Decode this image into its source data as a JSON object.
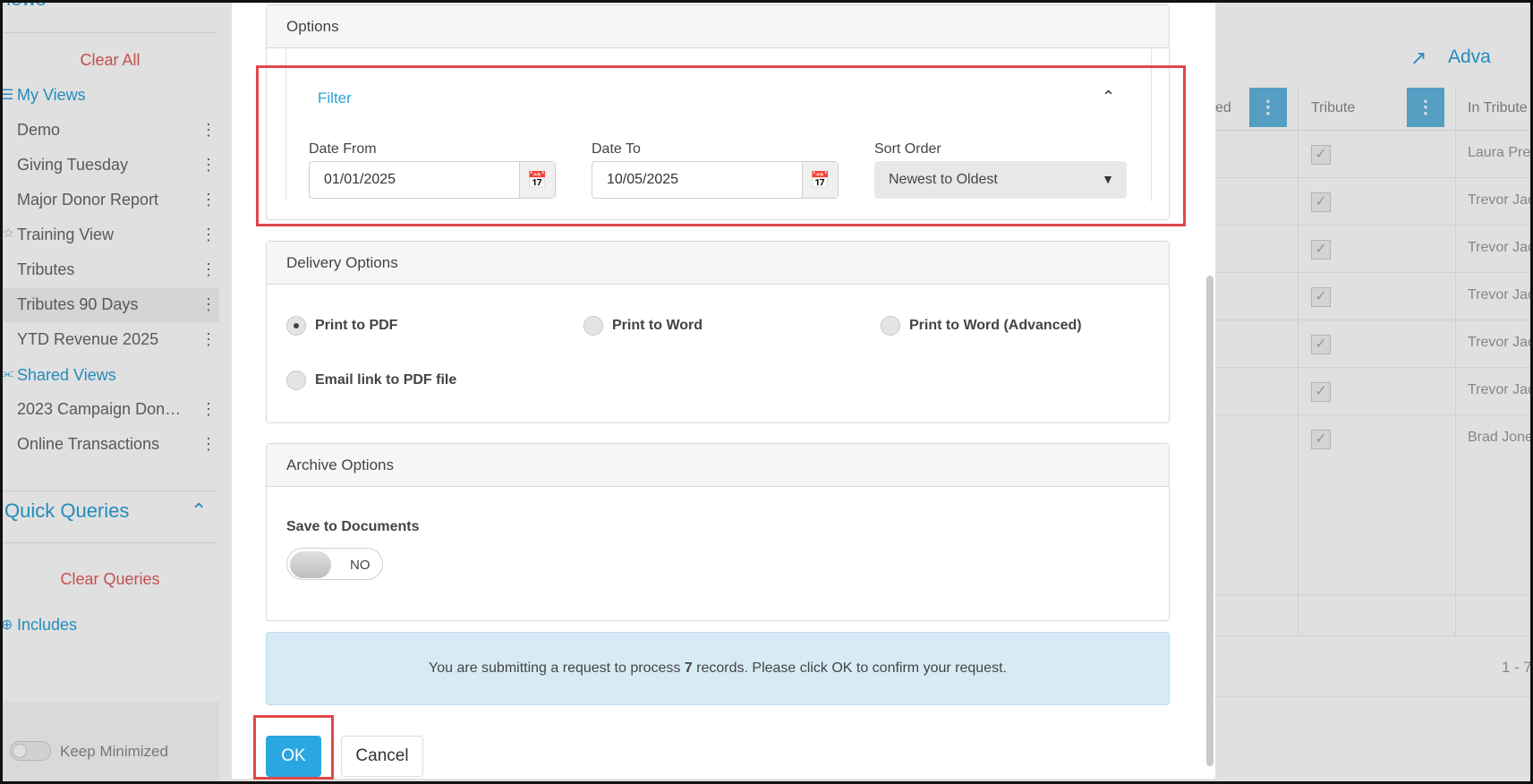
{
  "sidebar": {
    "views_title": "Views",
    "clear_all": "Clear All",
    "my_views_title": "My Views",
    "my_views": [
      "Demo",
      "Giving Tuesday",
      "Major Donor Report",
      "Training View",
      "Tributes",
      "Tributes 90 Days",
      "YTD Revenue 2025"
    ],
    "shared_views_title": "Shared Views",
    "shared_views": [
      "2023 Campaign Don…",
      "Online Transactions"
    ],
    "quick_queries_title": "Quick Queries",
    "clear_queries": "Clear Queries",
    "includes": "Includes",
    "keep_minimized": "Keep Minimized"
  },
  "background_grid": {
    "advanced_label": "Adva",
    "columns": [
      "ed",
      "Tribute",
      "In Tribute"
    ],
    "rows": [
      "Laura Pre",
      "Trevor Jac",
      "Trevor Jac",
      "Trevor Jac",
      "Trevor Jac",
      "Trevor Jac",
      "Brad Jone"
    ],
    "pager": "1 - 7"
  },
  "modal": {
    "options_title": "Options",
    "filter_title": "Filter",
    "date_from_label": "Date From",
    "date_from_value": "01/01/2025",
    "date_to_label": "Date To",
    "date_to_value": "10/05/2025",
    "sort_order_label": "Sort Order",
    "sort_order_value": "Newest to Oldest",
    "delivery_title": "Delivery Options",
    "delivery_options": [
      "Print to PDF",
      "Print to Word",
      "Print to Word (Advanced)",
      "Email link to PDF file"
    ],
    "delivery_selected": "Print to PDF",
    "archive_title": "Archive Options",
    "save_to_documents_label": "Save to Documents",
    "save_to_documents_state": "NO",
    "info_text_pre": "You are submitting a request to process ",
    "info_count": "7",
    "info_text_post": " records. Please click OK to confirm your request.",
    "ok_label": "OK",
    "cancel_label": "Cancel"
  },
  "colors": {
    "accent": "#2aa7e0",
    "link": "#2aa0d8",
    "danger": "#e05b5b",
    "highlight": "#e04848",
    "info_bg": "#d7ebf6"
  }
}
